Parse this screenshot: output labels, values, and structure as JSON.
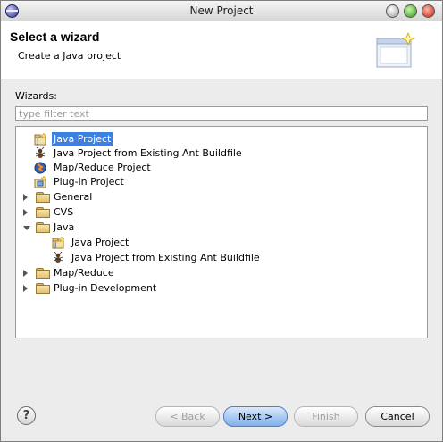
{
  "window": {
    "title": "New Project"
  },
  "header": {
    "title": "Select a wizard",
    "description": "Create a Java project"
  },
  "wizards_label": "Wizards:",
  "filter": {
    "placeholder": "type filter text",
    "value": ""
  },
  "tree": {
    "items": [
      {
        "label": "Java Project",
        "icon": "java-project-icon",
        "selected": true
      },
      {
        "label": "Java Project from Existing Ant Buildfile",
        "icon": "ant-icon"
      },
      {
        "label": "Map/Reduce Project",
        "icon": "mapreduce-project-icon"
      },
      {
        "label": "Plug-in Project",
        "icon": "plugin-project-icon"
      },
      {
        "label": "General",
        "icon": "folder-icon",
        "expanded": false
      },
      {
        "label": "CVS",
        "icon": "folder-icon",
        "expanded": false
      },
      {
        "label": "Java",
        "icon": "folder-icon",
        "expanded": true
      },
      {
        "label": "Java Project",
        "icon": "java-project-icon"
      },
      {
        "label": "Java Project from Existing Ant Buildfile",
        "icon": "ant-icon"
      },
      {
        "label": "Map/Reduce",
        "icon": "folder-icon",
        "expanded": false
      },
      {
        "label": "Plug-in Development",
        "icon": "folder-icon",
        "expanded": false
      }
    ]
  },
  "buttons": {
    "help": "?",
    "back": "< Back",
    "next": "Next >",
    "finish": "Finish",
    "cancel": "Cancel"
  },
  "colors": {
    "selection": "#3d80df",
    "default_button": "#7fb0ea"
  }
}
